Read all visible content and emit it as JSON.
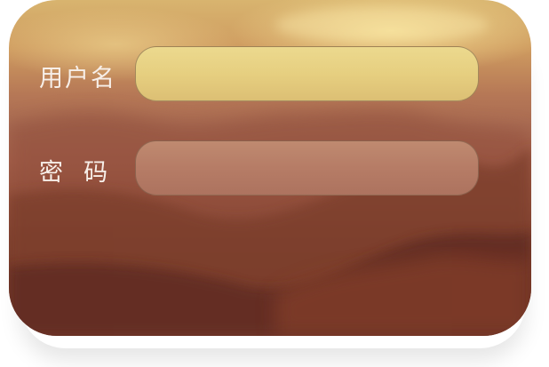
{
  "form": {
    "username_label": "用户名",
    "password_label": "密  码",
    "username_value": "",
    "password_value": ""
  },
  "colors": {
    "card_top": "#d8b46f",
    "card_bottom": "#652f25",
    "username_field": "#e6cf80",
    "password_field": "#b67c66",
    "label_text": "#f7efe9"
  }
}
